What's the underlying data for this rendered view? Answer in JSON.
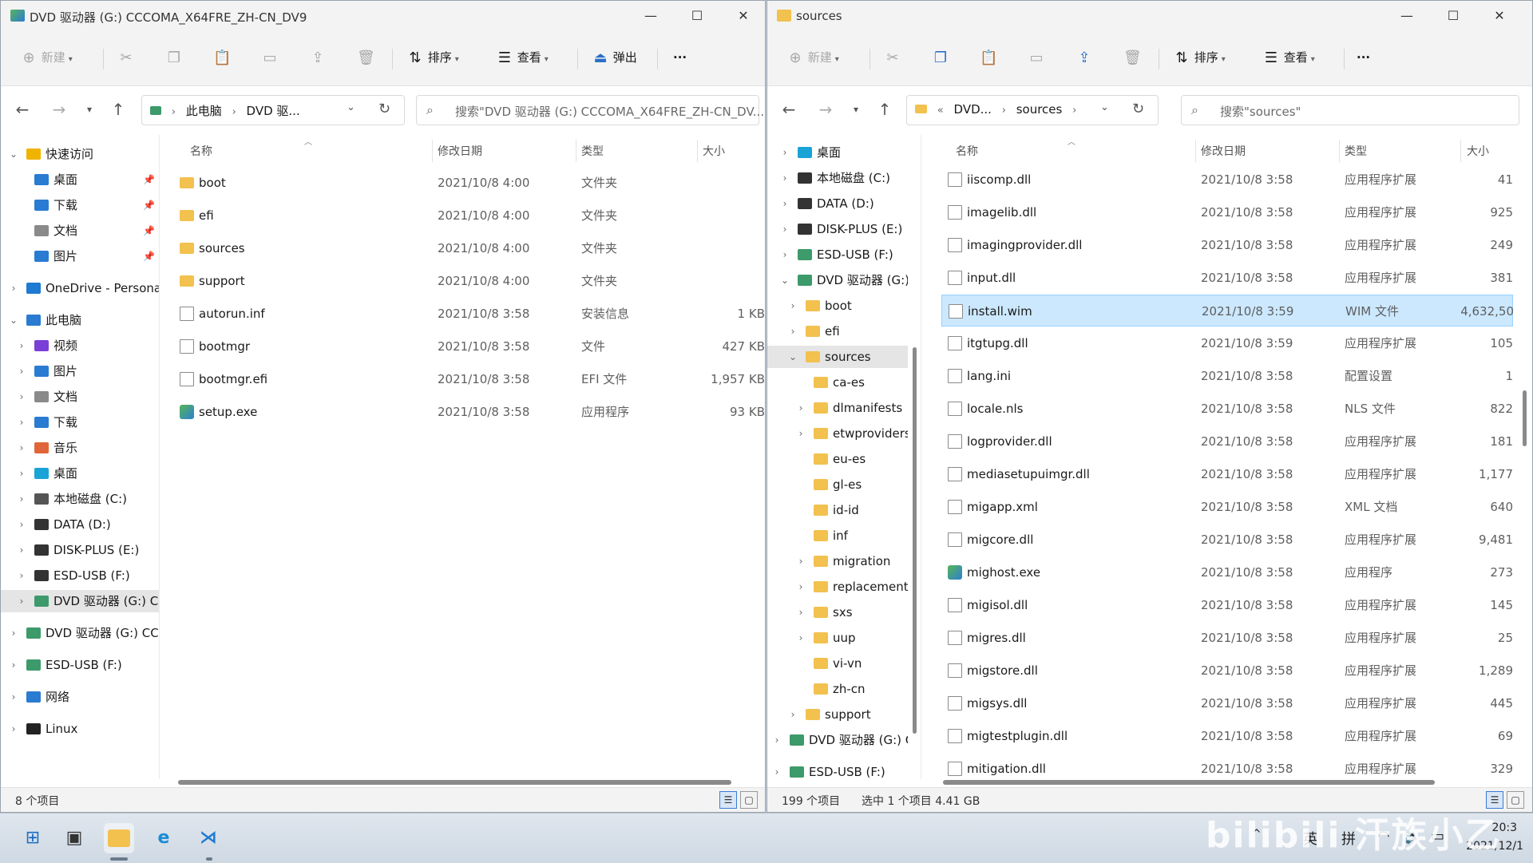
{
  "left_window": {
    "title": "DVD 驱动器 (G:) CCCOMA_X64FRE_ZH-CN_DV9",
    "toolbar": {
      "new_label": "新建",
      "sort_label": "排序",
      "view_label": "查看",
      "eject_label": "弹出",
      "more_label": "···"
    },
    "breadcrumb": [
      "此电脑",
      "DVD 驱..."
    ],
    "search_placeholder": "搜索\"DVD 驱动器 (G:) CCCOMA_X64FRE_ZH-CN_DV...",
    "columns": {
      "name": "名称",
      "date": "修改日期",
      "type": "类型",
      "size": "大小"
    },
    "nav": {
      "quick_access": "快速访问",
      "quick_items": [
        "桌面",
        "下载",
        "文档",
        "图片"
      ],
      "onedrive": "OneDrive - Persona",
      "this_pc": "此电脑",
      "pc_items": [
        "视频",
        "图片",
        "文档",
        "下载",
        "音乐",
        "桌面",
        "本地磁盘 (C:)",
        "DATA (D:)",
        "DISK-PLUS (E:)",
        "ESD-USB (F:)",
        "DVD 驱动器 (G:) CC"
      ],
      "extra_items": [
        "DVD 驱动器 (G:) CCC",
        "ESD-USB (F:)",
        "网络",
        "Linux"
      ]
    },
    "files": [
      {
        "name": "boot",
        "date": "2021/10/8 4:00",
        "type": "文件夹",
        "size": "",
        "icon": "folder"
      },
      {
        "name": "efi",
        "date": "2021/10/8 4:00",
        "type": "文件夹",
        "size": "",
        "icon": "folder"
      },
      {
        "name": "sources",
        "date": "2021/10/8 4:00",
        "type": "文件夹",
        "size": "",
        "icon": "folder"
      },
      {
        "name": "support",
        "date": "2021/10/8 4:00",
        "type": "文件夹",
        "size": "",
        "icon": "folder"
      },
      {
        "name": "autorun.inf",
        "date": "2021/10/8 3:58",
        "type": "安装信息",
        "size": "1 KB",
        "icon": "file"
      },
      {
        "name": "bootmgr",
        "date": "2021/10/8 3:58",
        "type": "文件",
        "size": "427 KB",
        "icon": "file"
      },
      {
        "name": "bootmgr.efi",
        "date": "2021/10/8 3:58",
        "type": "EFI 文件",
        "size": "1,957 KB",
        "icon": "file"
      },
      {
        "name": "setup.exe",
        "date": "2021/10/8 3:58",
        "type": "应用程序",
        "size": "93 KB",
        "icon": "exe"
      }
    ],
    "status": "8 个项目"
  },
  "right_window": {
    "title": "sources",
    "toolbar": {
      "new_label": "新建",
      "sort_label": "排序",
      "view_label": "查看",
      "more_label": "···"
    },
    "breadcrumb": [
      "DVD...",
      "sources"
    ],
    "search_placeholder": "搜索\"sources\"",
    "columns": {
      "name": "名称",
      "date": "修改日期",
      "type": "类型",
      "size": "大小"
    },
    "nav": [
      {
        "label": "桌面",
        "level": 0,
        "chevron": ">"
      },
      {
        "label": "本地磁盘 (C:)",
        "level": 0,
        "chevron": ">"
      },
      {
        "label": "DATA (D:)",
        "level": 0,
        "chevron": ">"
      },
      {
        "label": "DISK-PLUS (E:)",
        "level": 0,
        "chevron": ">"
      },
      {
        "label": "ESD-USB (F:)",
        "level": 0,
        "chevron": ">"
      },
      {
        "label": "DVD 驱动器 (G:)",
        "level": 0,
        "chevron": "v"
      },
      {
        "label": "boot",
        "level": 1,
        "chevron": ">"
      },
      {
        "label": "efi",
        "level": 1,
        "chevron": ">"
      },
      {
        "label": "sources",
        "level": 1,
        "chevron": "v",
        "selected": true
      },
      {
        "label": "ca-es",
        "level": 2,
        "chevron": ""
      },
      {
        "label": "dlmanifests",
        "level": 2,
        "chevron": ">"
      },
      {
        "label": "etwproviders",
        "level": 2,
        "chevron": ">"
      },
      {
        "label": "eu-es",
        "level": 2,
        "chevron": ""
      },
      {
        "label": "gl-es",
        "level": 2,
        "chevron": ""
      },
      {
        "label": "id-id",
        "level": 2,
        "chevron": ""
      },
      {
        "label": "inf",
        "level": 2,
        "chevron": ""
      },
      {
        "label": "migration",
        "level": 2,
        "chevron": ">"
      },
      {
        "label": "replacementmanifests",
        "level": 2,
        "chevron": ">"
      },
      {
        "label": "sxs",
        "level": 2,
        "chevron": ">"
      },
      {
        "label": "uup",
        "level": 2,
        "chevron": ">"
      },
      {
        "label": "vi-vn",
        "level": 2,
        "chevron": ""
      },
      {
        "label": "zh-cn",
        "level": 2,
        "chevron": ""
      },
      {
        "label": "support",
        "level": 1,
        "chevron": ">"
      },
      {
        "label": "DVD 驱动器 (G:) C",
        "level": -1,
        "chevron": ">"
      },
      {
        "label": "ESD-USB (F:)",
        "level": -1,
        "chevron": ">"
      }
    ],
    "files": [
      {
        "name": "iiscomp.dll",
        "date": "2021/10/8 3:58",
        "type": "应用程序扩展",
        "size": "41"
      },
      {
        "name": "imagelib.dll",
        "date": "2021/10/8 3:58",
        "type": "应用程序扩展",
        "size": "925"
      },
      {
        "name": "imagingprovider.dll",
        "date": "2021/10/8 3:58",
        "type": "应用程序扩展",
        "size": "249"
      },
      {
        "name": "input.dll",
        "date": "2021/10/8 3:58",
        "type": "应用程序扩展",
        "size": "381"
      },
      {
        "name": "install.wim",
        "date": "2021/10/8 3:59",
        "type": "WIM 文件",
        "size": "4,632,50",
        "selected": true
      },
      {
        "name": "itgtupg.dll",
        "date": "2021/10/8 3:59",
        "type": "应用程序扩展",
        "size": "105"
      },
      {
        "name": "lang.ini",
        "date": "2021/10/8 3:58",
        "type": "配置设置",
        "size": "1"
      },
      {
        "name": "locale.nls",
        "date": "2021/10/8 3:58",
        "type": "NLS 文件",
        "size": "822"
      },
      {
        "name": "logprovider.dll",
        "date": "2021/10/8 3:58",
        "type": "应用程序扩展",
        "size": "181"
      },
      {
        "name": "mediasetupuimgr.dll",
        "date": "2021/10/8 3:58",
        "type": "应用程序扩展",
        "size": "1,177"
      },
      {
        "name": "migapp.xml",
        "date": "2021/10/8 3:58",
        "type": "XML 文档",
        "size": "640"
      },
      {
        "name": "migcore.dll",
        "date": "2021/10/8 3:58",
        "type": "应用程序扩展",
        "size": "9,481"
      },
      {
        "name": "mighost.exe",
        "date": "2021/10/8 3:58",
        "type": "应用程序",
        "size": "273"
      },
      {
        "name": "migisol.dll",
        "date": "2021/10/8 3:58",
        "type": "应用程序扩展",
        "size": "145"
      },
      {
        "name": "migres.dll",
        "date": "2021/10/8 3:58",
        "type": "应用程序扩展",
        "size": "25"
      },
      {
        "name": "migstore.dll",
        "date": "2021/10/8 3:58",
        "type": "应用程序扩展",
        "size": "1,289"
      },
      {
        "name": "migsys.dll",
        "date": "2021/10/8 3:58",
        "type": "应用程序扩展",
        "size": "445"
      },
      {
        "name": "migtestplugin.dll",
        "date": "2021/10/8 3:58",
        "type": "应用程序扩展",
        "size": "69"
      },
      {
        "name": "mitigation.dll",
        "date": "2021/10/8 3:58",
        "type": "应用程序扩展",
        "size": "329"
      }
    ],
    "status_count": "199 个项目",
    "status_selection": "选中 1 个项目  4.41 GB"
  },
  "taskbar": {
    "tray_lang": "英",
    "tray_ime": "拼",
    "time": "20:3",
    "date": "2021/12/1"
  },
  "watermark": "bilibili 汗族小乙",
  "colors": {
    "selection_bg": "#cce8ff",
    "folder": "#f2c14e",
    "accent": "#0067c0"
  }
}
